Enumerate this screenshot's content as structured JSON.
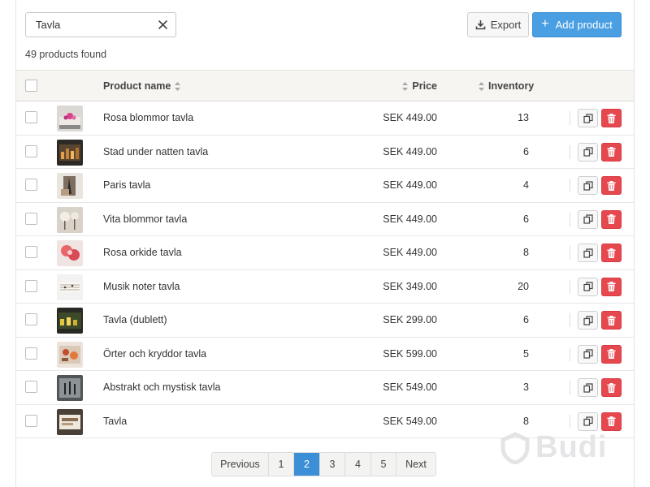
{
  "search": {
    "value": "Tavla",
    "placeholder": ""
  },
  "results_count_text": "49 products found",
  "toolbar": {
    "export_label": "Export",
    "add_label": "Add product"
  },
  "table": {
    "headers": {
      "name": "Product name",
      "price": "Price",
      "inventory": "Inventory"
    },
    "rows": [
      {
        "name": "Rosa blommor tavla",
        "price": "SEK 449.00",
        "inventory": "13"
      },
      {
        "name": "Stad under natten tavla",
        "price": "SEK 449.00",
        "inventory": "6"
      },
      {
        "name": "Paris tavla",
        "price": "SEK 449.00",
        "inventory": "4"
      },
      {
        "name": "Vita blommor tavla",
        "price": "SEK 449.00",
        "inventory": "6"
      },
      {
        "name": "Rosa orkide tavla",
        "price": "SEK 449.00",
        "inventory": "8"
      },
      {
        "name": "Musik noter tavla",
        "price": "SEK 349.00",
        "inventory": "20"
      },
      {
        "name": "Tavla (dublett)",
        "price": "SEK 299.00",
        "inventory": "6"
      },
      {
        "name": "Örter och kryddor tavla",
        "price": "SEK 599.00",
        "inventory": "5"
      },
      {
        "name": "Abstrakt och mystisk tavla",
        "price": "SEK 549.00",
        "inventory": "3"
      },
      {
        "name": "Tavla",
        "price": "SEK 549.00",
        "inventory": "8"
      }
    ]
  },
  "pagination": {
    "previous_label": "Previous",
    "pages": [
      "1",
      "2",
      "3",
      "4",
      "5"
    ],
    "current_page": "2",
    "next_label": "Next"
  },
  "watermark": "Budi",
  "colors": {
    "primary": "#4a9fe3",
    "danger": "#e5484f",
    "active_page": "#3c8fd6",
    "header_bg": "#f6f5f2"
  }
}
